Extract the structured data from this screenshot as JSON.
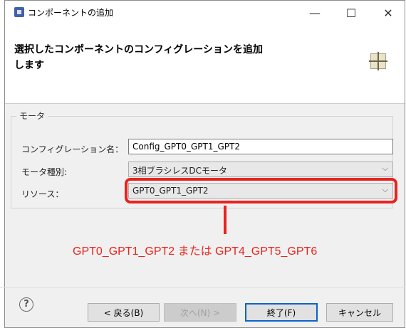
{
  "window": {
    "title": "コンポーネントの追加",
    "minimize_glyph": "—",
    "maximize_glyph": "☐",
    "close_glyph": "✕"
  },
  "header": {
    "text": "選択したコンポーネントのコンフィグレーションを追加します",
    "icon": "wizard-grid-icon"
  },
  "group": {
    "title": "モータ",
    "config_name_label": "コンフィグレーション名：",
    "config_name_value": "Config_GPT0_GPT1_GPT2",
    "motor_type_label": "モータ種別:",
    "motor_type_value": "3相ブラシレスDCモータ",
    "resource_label": "リソース：",
    "resource_value": "GPT0_GPT1_GPT2"
  },
  "annotation": {
    "text": "GPT0_GPT1_GPT2 または GPT4_GPT5_GPT6",
    "color": "#e8231e"
  },
  "footer": {
    "help_glyph": "?",
    "back_label": "< 戻る(B)",
    "next_label": "次へ(N) >",
    "finish_label": "終了(F)",
    "cancel_label": "キャンセル"
  },
  "colors": {
    "accent": "#0a64c8",
    "highlight": "#e8231e"
  }
}
